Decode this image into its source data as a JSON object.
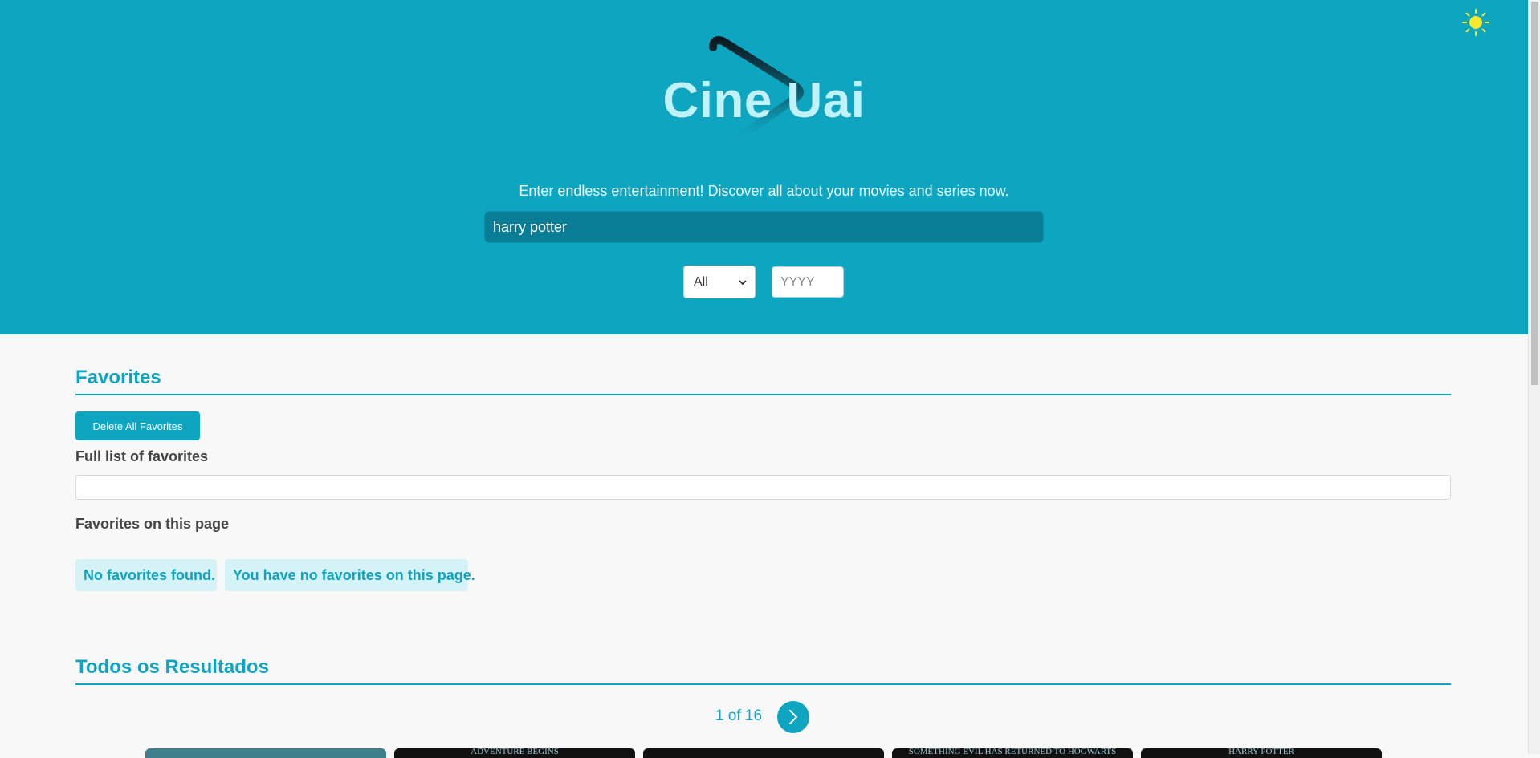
{
  "app": {
    "brand": "Cine Uai",
    "tagline": "Enter endless entertainment! Discover all about your movies and series now.",
    "theme_icon": "sun-icon"
  },
  "search": {
    "value": "harry potter",
    "type_selected": "All",
    "year_placeholder": "YYYY"
  },
  "favorites": {
    "title": "Favorites",
    "delete_label": "Delete All Favorites",
    "full_list_heading": "Full list of favorites",
    "page_heading": "Favorites on this page",
    "no_found": "No favorites found.",
    "no_on_page": "You have no favorites on this page."
  },
  "results": {
    "title": "Todos os Resultados",
    "page_label": "1 of 16",
    "next_icon": "chevron-right-icon",
    "posters": [
      {
        "caption": ""
      },
      {
        "caption": "ADVENTURE BEGINS"
      },
      {
        "caption": ""
      },
      {
        "caption": "SOMETHING EVIL HAS RETURNED TO HOGWARTS"
      },
      {
        "caption": "HARRY POTTER"
      }
    ]
  },
  "colors": {
    "accent": "#0ea5c1",
    "search_bg": "#087d95",
    "brand_text": "#bff2fb",
    "chip_bg": "#d5f2f7"
  }
}
